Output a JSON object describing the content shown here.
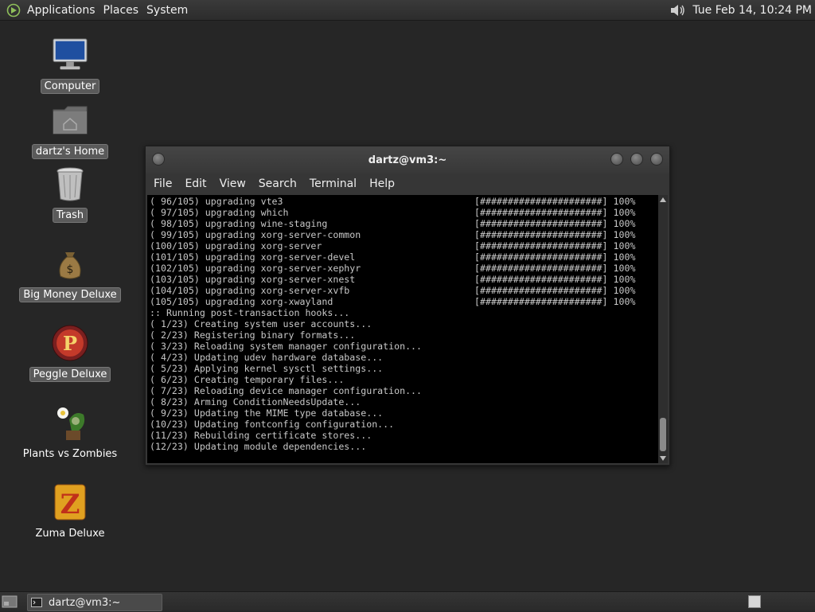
{
  "top_panel": {
    "menus": [
      "Applications",
      "Places",
      "System"
    ],
    "clock": "Tue Feb 14, 10:24 PM",
    "icons": [
      "distro-logo-icon",
      "volume-icon"
    ]
  },
  "desktop": {
    "icons": [
      {
        "label": "Computer",
        "icon": "computer-icon"
      },
      {
        "label": "dartz's Home",
        "icon": "home-folder-icon"
      },
      {
        "label": "Trash",
        "icon": "trash-icon"
      },
      {
        "label": "Big Money Deluxe",
        "icon": "money-bag-icon"
      },
      {
        "label": "Peggle Deluxe",
        "icon": "peggle-icon"
      },
      {
        "label": "Plants vs Zombies",
        "icon": "plants-vs-zombies-icon"
      },
      {
        "label": "Zuma Deluxe",
        "icon": "zuma-icon"
      }
    ]
  },
  "terminal": {
    "title": "dartz@vm3:~",
    "menu": [
      "File",
      "Edit",
      "View",
      "Search",
      "Terminal",
      "Help"
    ],
    "progress_bar": "[######################] 100%",
    "lines": [
      {
        "text": "( 96/105) upgrading vte3",
        "progress": true
      },
      {
        "text": "( 97/105) upgrading which",
        "progress": true
      },
      {
        "text": "( 98/105) upgrading wine-staging",
        "progress": true
      },
      {
        "text": "( 99/105) upgrading xorg-server-common",
        "progress": true
      },
      {
        "text": "(100/105) upgrading xorg-server",
        "progress": true
      },
      {
        "text": "(101/105) upgrading xorg-server-devel",
        "progress": true
      },
      {
        "text": "(102/105) upgrading xorg-server-xephyr",
        "progress": true
      },
      {
        "text": "(103/105) upgrading xorg-server-xnest",
        "progress": true
      },
      {
        "text": "(104/105) upgrading xorg-server-xvfb",
        "progress": true
      },
      {
        "text": "(105/105) upgrading xorg-xwayland",
        "progress": true
      },
      {
        "text": ":: Running post-transaction hooks...",
        "progress": false
      },
      {
        "text": "( 1/23) Creating system user accounts...",
        "progress": false
      },
      {
        "text": "( 2/23) Registering binary formats...",
        "progress": false
      },
      {
        "text": "( 3/23) Reloading system manager configuration...",
        "progress": false
      },
      {
        "text": "( 4/23) Updating udev hardware database...",
        "progress": false
      },
      {
        "text": "( 5/23) Applying kernel sysctl settings...",
        "progress": false
      },
      {
        "text": "( 6/23) Creating temporary files...",
        "progress": false
      },
      {
        "text": "( 7/23) Reloading device manager configuration...",
        "progress": false
      },
      {
        "text": "( 8/23) Arming ConditionNeedsUpdate...",
        "progress": false
      },
      {
        "text": "( 9/23) Updating the MIME type database...",
        "progress": false
      },
      {
        "text": "(10/23) Updating fontconfig configuration...",
        "progress": false
      },
      {
        "text": "(11/23) Rebuilding certificate stores...",
        "progress": false
      },
      {
        "text": "(12/23) Updating module dependencies...",
        "progress": false
      }
    ]
  },
  "taskbar": {
    "window_button": "dartz@vm3:~"
  },
  "colors": {
    "desktop_bg": "#262626",
    "terminal_bg": "#000000",
    "terminal_fg": "#c8c8c8"
  }
}
